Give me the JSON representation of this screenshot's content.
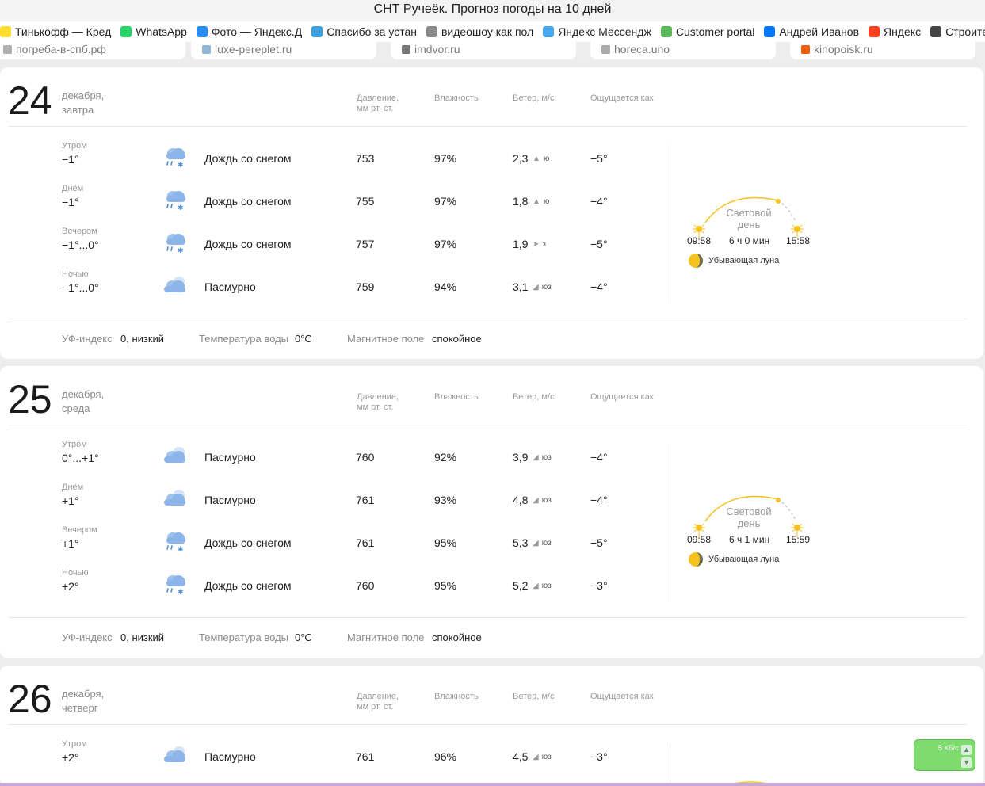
{
  "window": {
    "title": "СНТ Ручеёк. Прогноз погоды на 10 дней"
  },
  "bookmarks": [
    {
      "label": "Тинькофф — Кред",
      "icon": "tinkoff-icon",
      "color": "#ffdd2d"
    },
    {
      "label": "WhatsApp",
      "icon": "whatsapp-icon",
      "color": "#25d366"
    },
    {
      "label": "Фото — Яндекс.Д",
      "icon": "yandex-disk-icon",
      "color": "#2a8cf0"
    },
    {
      "label": "Спасибо за устан",
      "icon": "thanks-icon",
      "color": "#3aa0e0"
    },
    {
      "label": "видеошоу как пол",
      "icon": "video-icon",
      "color": "#888888"
    },
    {
      "label": "Яндекс Мессендж",
      "icon": "messenger-icon",
      "color": "#4aa8f0"
    },
    {
      "label": "Customer portal",
      "icon": "portal-icon",
      "color": "#5cb85c"
    },
    {
      "label": "Андрей Иванов",
      "icon": "vk-icon",
      "color": "#0077ff"
    },
    {
      "label": "Яндекс",
      "icon": "yandex-icon",
      "color": "#fc3f1d"
    },
    {
      "label": "Строительные м",
      "icon": "construction-icon",
      "color": "#444444"
    }
  ],
  "tiles": [
    {
      "label": "погреба-в-спб.рф",
      "icon": "home-icon"
    },
    {
      "label": "luxe-pereplet.ru",
      "icon": "book-icon"
    },
    {
      "label": "imdvor.ru",
      "icon": "tree-icon"
    },
    {
      "label": "horeca.uno",
      "icon": "bars-icon"
    },
    {
      "label": "kinopoisk.ru",
      "icon": "kinopoisk-icon"
    }
  ],
  "columns": {
    "pressure": "Давление,\nмм рт. ст.",
    "humidity": "Влажность",
    "wind": "Ветер, м/с",
    "feels": "Ощущается как"
  },
  "footer_labels": {
    "uv": "УФ-индекс",
    "water": "Температура воды",
    "magnetic": "Магнитное поле"
  },
  "sun_label": "Световой\nдень",
  "days": [
    {
      "day": "24",
      "month": "декабря,",
      "weekday": "завтра",
      "parts": [
        {
          "name": "Утром",
          "temp": "−1°",
          "icon": "rain-snow-icon",
          "cond": "Дождь со снегом",
          "pressure": "753",
          "humidity": "97%",
          "wind": "2,3",
          "wind_arrow": "▲",
          "wind_dir": "ю",
          "feels": "−5°"
        },
        {
          "name": "Днём",
          "temp": "−1°",
          "icon": "rain-snow-icon",
          "cond": "Дождь со снегом",
          "pressure": "755",
          "humidity": "97%",
          "wind": "1,8",
          "wind_arrow": "▲",
          "wind_dir": "ю",
          "feels": "−4°"
        },
        {
          "name": "Вечером",
          "temp": "−1°...0°",
          "icon": "rain-snow-icon",
          "cond": "Дождь со снегом",
          "pressure": "757",
          "humidity": "97%",
          "wind": "1,9",
          "wind_arrow": "➤",
          "wind_dir": "з",
          "feels": "−5°"
        },
        {
          "name": "Ночью",
          "temp": "−1°...0°",
          "icon": "overcast-icon",
          "cond": "Пасмурно",
          "pressure": "759",
          "humidity": "94%",
          "wind": "3,1",
          "wind_arrow": "◢",
          "wind_dir": "юз",
          "feels": "−4°"
        }
      ],
      "sunrise": "09:58",
      "daylength": "6 ч 0 мин",
      "sunset": "15:58",
      "moon": "Убывающая луна",
      "uv": "0, низкий",
      "water": "0°C",
      "magnetic": "спокойное"
    },
    {
      "day": "25",
      "month": "декабря,",
      "weekday": "среда",
      "parts": [
        {
          "name": "Утром",
          "temp": "0°...+1°",
          "icon": "overcast-icon",
          "cond": "Пасмурно",
          "pressure": "760",
          "humidity": "92%",
          "wind": "3,9",
          "wind_arrow": "◢",
          "wind_dir": "юз",
          "feels": "−4°"
        },
        {
          "name": "Днём",
          "temp": "+1°",
          "icon": "overcast-icon",
          "cond": "Пасмурно",
          "pressure": "761",
          "humidity": "93%",
          "wind": "4,8",
          "wind_arrow": "◢",
          "wind_dir": "юз",
          "feels": "−4°"
        },
        {
          "name": "Вечером",
          "temp": "+1°",
          "icon": "rain-snow-icon",
          "cond": "Дождь со снегом",
          "pressure": "761",
          "humidity": "95%",
          "wind": "5,3",
          "wind_arrow": "◢",
          "wind_dir": "юз",
          "feels": "−5°"
        },
        {
          "name": "Ночью",
          "temp": "+2°",
          "icon": "rain-snow-icon",
          "cond": "Дождь со снегом",
          "pressure": "760",
          "humidity": "95%",
          "wind": "5,2",
          "wind_arrow": "◢",
          "wind_dir": "юз",
          "feels": "−3°"
        }
      ],
      "sunrise": "09:58",
      "daylength": "6 ч 1 мин",
      "sunset": "15:59",
      "moon": "Убывающая луна",
      "uv": "0, низкий",
      "water": "0°C",
      "magnetic": "спокойное"
    },
    {
      "day": "26",
      "month": "декабря,",
      "weekday": "четверг",
      "parts": [
        {
          "name": "Утром",
          "temp": "+2°",
          "icon": "overcast-icon",
          "cond": "Пасмурно",
          "pressure": "761",
          "humidity": "96%",
          "wind": "4,5",
          "wind_arrow": "◢",
          "wind_dir": "юз",
          "feels": "−3°"
        }
      ]
    }
  ],
  "widget": {
    "label": "5 КБ/с"
  },
  "colors": {
    "sun": "#f6c21e",
    "cloud": "#9fc3ee",
    "drop": "#4d90d6",
    "accent_green": "#7ddc6d"
  }
}
